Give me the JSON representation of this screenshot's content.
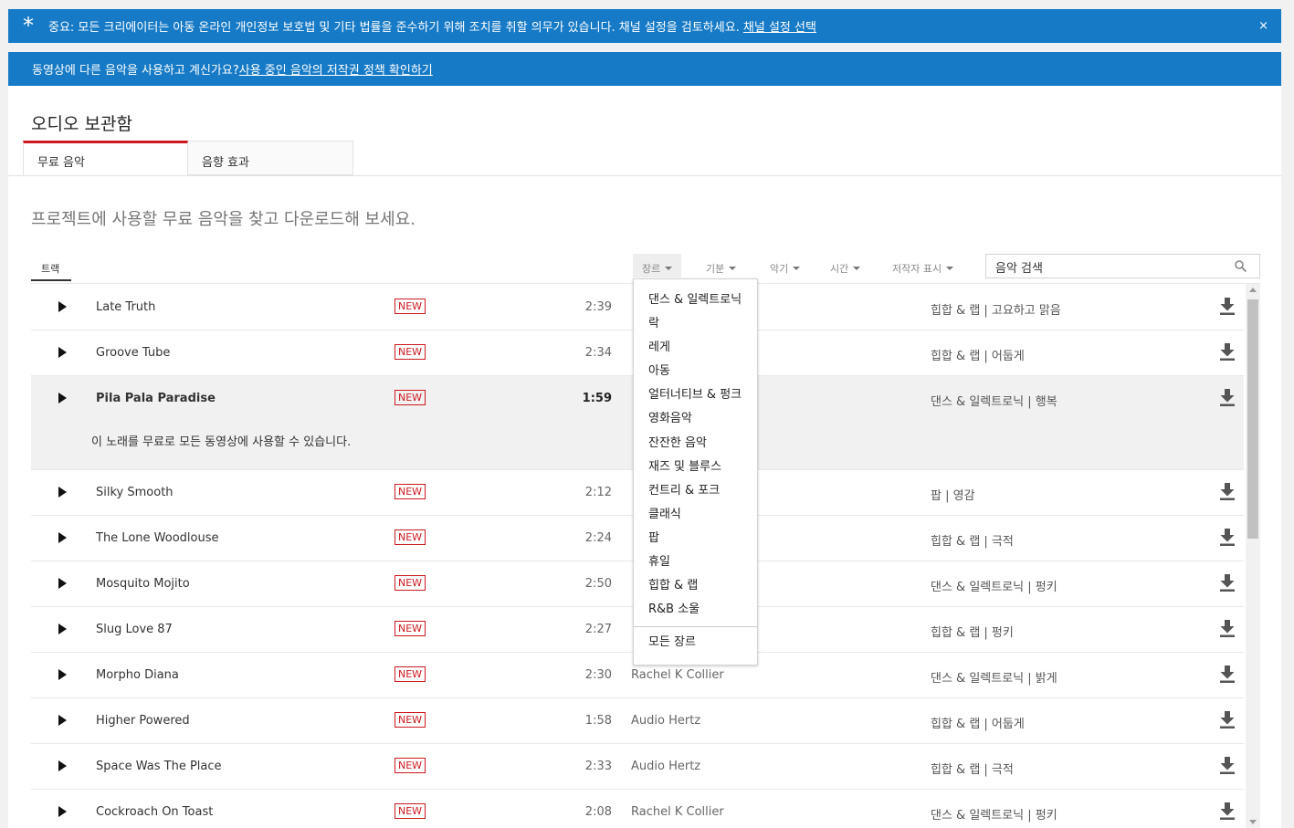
{
  "legal_banner": {
    "icon": "asterisk-icon",
    "text": "중요: 모든 크리에이터는 아동 온라인 개인정보 보호법 및 기타 법률을 준수하기 위해 조치를 취할 의무가 있습니다. 채널 설정을 검토하세요. ",
    "link": "채널 설정 선택",
    "close": "×"
  },
  "music_banner": {
    "text": "동영상에 다른 음악을 사용하고 계신가요? ",
    "link": "사용 중인 음악의 저작권 정책 확인하기"
  },
  "page_title": "오디오 보관함",
  "tabs": [
    {
      "label": "무료 음악",
      "active": true
    },
    {
      "label": "음향 효과",
      "active": false
    }
  ],
  "subtitle": "프로젝트에 사용할 무료 음악을 찾고 다운로드해 보세요.",
  "filters": {
    "tracks_tab": "트랙",
    "genre": "장르",
    "mood": "기분",
    "instrument": "악기",
    "duration": "시간",
    "attribution": "저작자 표시"
  },
  "search": {
    "placeholder": "음악 검색"
  },
  "tracks": [
    {
      "title": "Late Truth",
      "badge": "NEW",
      "duration": "2:39",
      "artist": "",
      "genre": "힙합 & 랩 | 고요하고 맑음"
    },
    {
      "title": "Groove Tube",
      "badge": "NEW",
      "duration": "2:34",
      "artist": "",
      "genre": "힙합 & 랩 | 어둡게"
    },
    {
      "title": "Pila Pala Paradise",
      "badge": "NEW",
      "duration": "1:59",
      "artist": "",
      "genre": "댄스 & 일렉트로닉 | 행복",
      "description": "이 노래를 무료로 모든 동영상에 사용할 수 있습니다."
    },
    {
      "title": "Silky Smooth",
      "badge": "NEW",
      "duration": "2:12",
      "artist": "",
      "genre": "팝 | 영감"
    },
    {
      "title": "The Lone Woodlouse",
      "badge": "NEW",
      "duration": "2:24",
      "artist": "",
      "genre": "힙합 & 랩 | 극적"
    },
    {
      "title": "Mosquito Mojito",
      "badge": "NEW",
      "duration": "2:50",
      "artist": "",
      "genre": "댄스 & 일렉트로닉 | 펑키"
    },
    {
      "title": "Slug Love 87",
      "badge": "NEW",
      "duration": "2:27",
      "artist": "",
      "genre": "힙합 & 랩 | 펑키"
    },
    {
      "title": "Morpho Diana",
      "badge": "NEW",
      "duration": "2:30",
      "artist": "Rachel K Collier",
      "genre": "댄스 & 일렉트로닉 | 밝게"
    },
    {
      "title": "Higher Powered",
      "badge": "NEW",
      "duration": "1:58",
      "artist": "Audio Hertz",
      "genre": "힙합 & 랩 | 어둡게"
    },
    {
      "title": "Space Was The Place",
      "badge": "NEW",
      "duration": "2:33",
      "artist": "Audio Hertz",
      "genre": "힙합 & 랩 | 극적"
    },
    {
      "title": "Cockroach On Toast",
      "badge": "NEW",
      "duration": "2:08",
      "artist": "Rachel K Collier",
      "genre": "댄스 & 일렉트로닉 | 펑키"
    }
  ],
  "genre_menu": {
    "items": [
      "댄스 & 일렉트로닉",
      "락",
      "레게",
      "아동",
      "얼터너티브 & 펑크",
      "영화음악",
      "잔잔한 음악",
      "재즈 및 블루스",
      "컨트리 & 포크",
      "클래식",
      "팝",
      "휴일",
      "힙합 & 랩",
      "R&B 소울"
    ],
    "all": "모든 장르"
  },
  "colors": {
    "accent_blue": "#167ac6",
    "accent_red": "#cc181e"
  }
}
